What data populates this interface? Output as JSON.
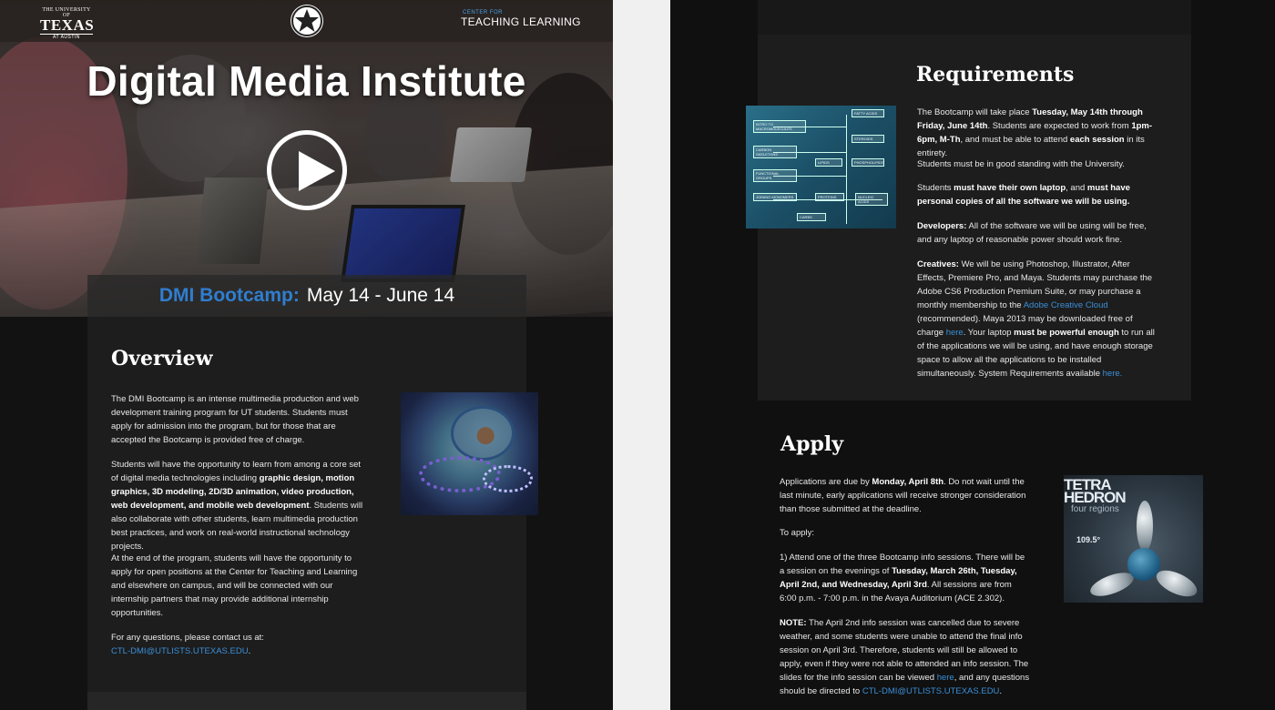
{
  "left": {
    "header": {
      "ut_logo_small": "THE UNIVERSITY OF",
      "ut_logo_big": "TEXAS",
      "ut_logo_sub": "AT AUSTIN",
      "ctl_logo_small": "CENTER FOR",
      "ctl_logo_main": "TEACHING LEARNING"
    },
    "hero": {
      "title": "Digital Media Institute",
      "banner_label": "DMI Bootcamp:",
      "banner_dates": "May 14 - June 14"
    },
    "overview": {
      "title": "Overview",
      "p1": "The DMI Bootcamp is an intense multimedia production and web development training program for UT students. Students must apply for admission into the program, but for those that are accepted the Bootcamp is provided free of charge.",
      "p2_a": "Students will have the opportunity to learn from among a core set of digital media technologies including ",
      "p2_b": "graphic design, motion graphics, 3D modeling, 2D/3D animation, video production, web development, and mobile web development",
      "p2_c": ". Students will also collaborate with other students, learn multimedia production best practices, and work on real-world instructional technology projects.",
      "p3": "At the end of the program, students will have the opportunity to apply for open positions at the Center for Teaching and Learning and elsewhere on campus, and will be connected with our internship partners that may provide additional internship opportunities.",
      "p4": "For any questions, please contact us at:",
      "email": "CTL-DMI@UTLISTS.UTEXAS.EDU",
      "email_suffix": "."
    }
  },
  "right": {
    "requirements": {
      "title": "Requirements",
      "p1_a": "The Bootcamp will take place ",
      "p1_b": "Tuesday, May 14th through Friday, June 14th",
      "p1_c": ". Students are expected to work from ",
      "p1_d": "1pm-6pm, M-Th",
      "p1_e": ", and must be able to attend ",
      "p1_f": "each session",
      "p1_g": " in its entirety.",
      "p2": "Students must be in good standing with the University.",
      "p3_a": "Students ",
      "p3_b": "must have their own laptop",
      "p3_c": ", and ",
      "p3_d": "must have personal copies of all the software we will be using.",
      "p4_a": "Developers:",
      "p4_b": " All of the software we will be using will be free, and any laptop of reasonable power should work fine.",
      "p5_a": "Creatives:",
      "p5_b": " We will be using Photoshop, Illustrator, After Effects, Premiere Pro, and Maya. Students may purchase the Adobe CS6 Production Premium Suite, or may purchase a monthly membership to the ",
      "p5_link1": "Adobe Creative Cloud",
      "p5_c": " (recommended). Maya 2013 may be downloaded free of charge ",
      "p5_link2": "here",
      "p5_d": ". Your laptop ",
      "p5_e": "must be powerful enough",
      "p5_f": " to run all of the applications we will be using, and have enough storage space to allow all the applications to be installed simultaneously. System Requirements available ",
      "p5_link3": "here.",
      "flowchart_labels": [
        "INTRO TO MACROMOLECULES",
        "CARBON SKELETONS",
        "FUNCTIONAL GROUPS",
        "JOINING MONOMERS",
        "LIPIDS",
        "PROTEINS",
        "CARBS",
        "FATTY ACIDS",
        "STEROIDS",
        "PHOSPHOLIPIDS",
        "NUCLEIC ACIDS"
      ]
    },
    "apply": {
      "title": "Apply",
      "p1_a": "Applications are due by ",
      "p1_b": "Monday, April 8th",
      "p1_c": ". Do not wait until the last minute, early applications will receive stronger consideration than those submitted at the deadline.",
      "p2": "To apply:",
      "p3_a": "1) Attend one of the three Bootcamp info sessions. There will be a session on the evenings of ",
      "p3_b": "Tuesday, March 26th, Tuesday, April 2nd, and Wednesday, April 3rd",
      "p3_c": ". All sessions are from 6:00 p.m. - 7:00 p.m. in the Avaya Auditorium (ACE 2.302).",
      "p4_a": "NOTE:",
      "p4_b": " The April 2nd info session was cancelled due to severe weather, and some students were unable to attend the final info session on April 3rd. Therefore, students will still be allowed to apply, even if they were not able to attended an info session. The slides for the info session can be viewed ",
      "p4_link": "here",
      "p4_c": ", and any questions should be directed to ",
      "p4_email": "CTL-DMI@UTLISTS.UTEXAS.EDU",
      "p4_d": ".",
      "tetra_line1": "TETRA",
      "tetra_line2": "HEDRON",
      "tetra_sub": "four regions",
      "tetra_angle": "109.5°"
    }
  },
  "colors": {
    "accent_blue": "#2f7ed0",
    "link_blue": "#3a8fd8",
    "card_bg": "#1d1d1d",
    "page_bg": "#121212"
  },
  "icons": {
    "star": "star-icon",
    "play": "play-icon"
  }
}
